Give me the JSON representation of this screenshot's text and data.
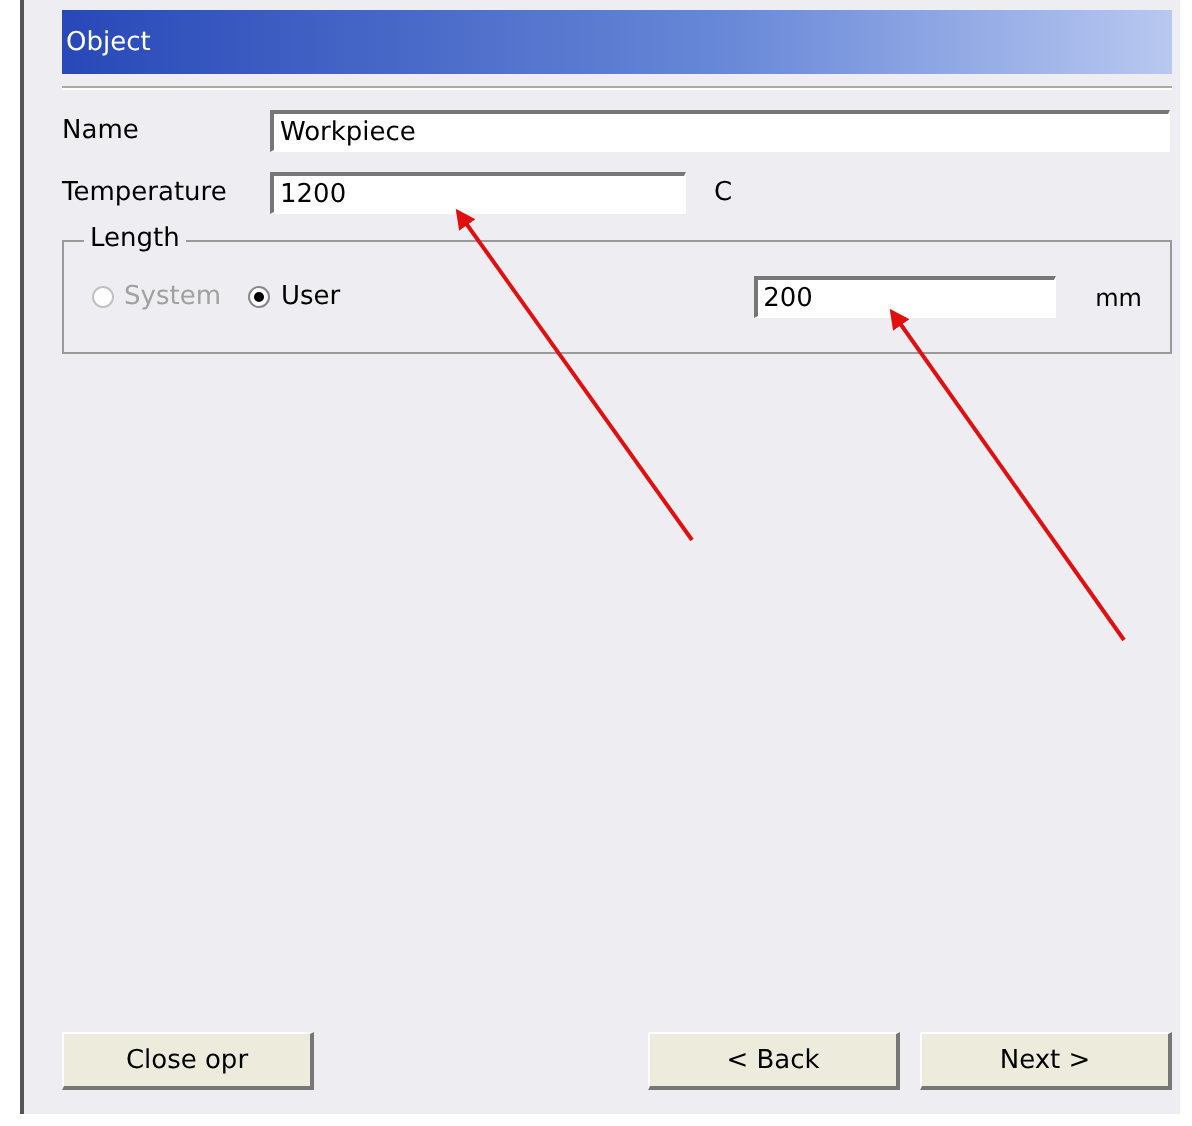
{
  "header": {
    "title": "Object"
  },
  "fields": [
    {
      "label": "Name",
      "value": "Workpiece"
    },
    {
      "label": "Temperature",
      "value": "1200",
      "unit": "C"
    }
  ],
  "length_group": {
    "title": "Length",
    "options": [
      {
        "label": "System",
        "selected": false,
        "disabled": true
      },
      {
        "label": "User",
        "selected": true,
        "disabled": false
      }
    ],
    "value": "200",
    "unit": "mm"
  },
  "buttons": [
    {
      "label": "Close opr",
      "kind": "left"
    },
    {
      "label": "< Back",
      "kind": "right"
    },
    {
      "label": "Next >",
      "kind": "right"
    }
  ]
}
